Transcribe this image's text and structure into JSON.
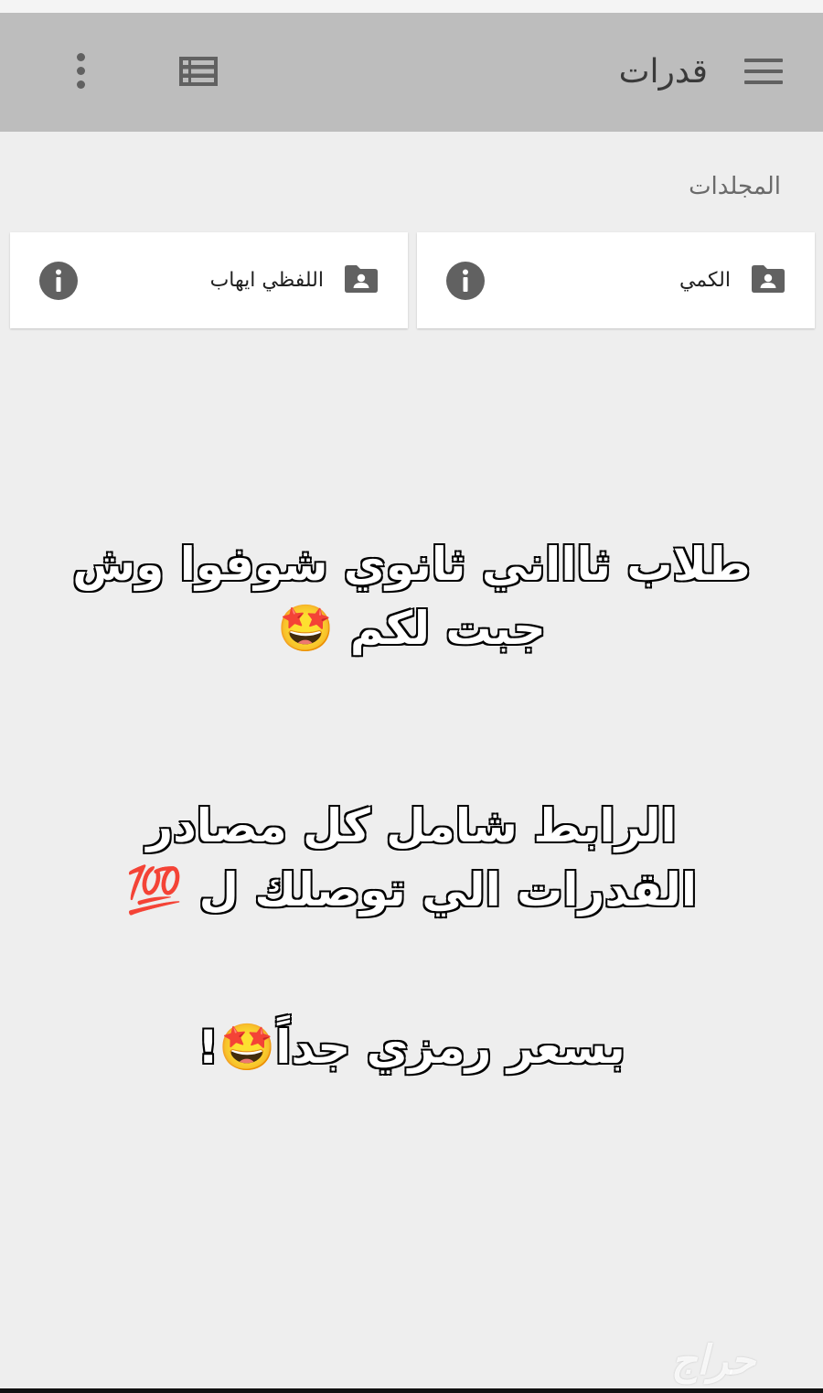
{
  "app_bar": {
    "title": "قدرات",
    "background": "#bdbdbd",
    "icons": {
      "menu": "hamburger-menu-icon",
      "view": "list-view-icon",
      "more": "more-vert-icon"
    }
  },
  "folders_section": {
    "label": "المجلدات",
    "items": [
      {
        "name": "الكمي",
        "icon": "shared-folder-icon",
        "info_icon": "info-icon"
      },
      {
        "name": "اللفظي ايهاب",
        "icon": "shared-folder-icon",
        "info_icon": "info-icon"
      }
    ]
  },
  "promo": {
    "line1": "طلاب ثاااني ثانوي شوفوا  وش جبت لكم",
    "line1_emoji": "🤩",
    "line2": "الرابط شامل كل مصادر  القدرات الي توصلك ل",
    "line2_emoji": "💯",
    "line3": "بسعر رمزي جداً",
    "line3_emoji": "🤩",
    "line3_suffix": "!"
  },
  "watermark": {
    "text": "حراج"
  }
}
